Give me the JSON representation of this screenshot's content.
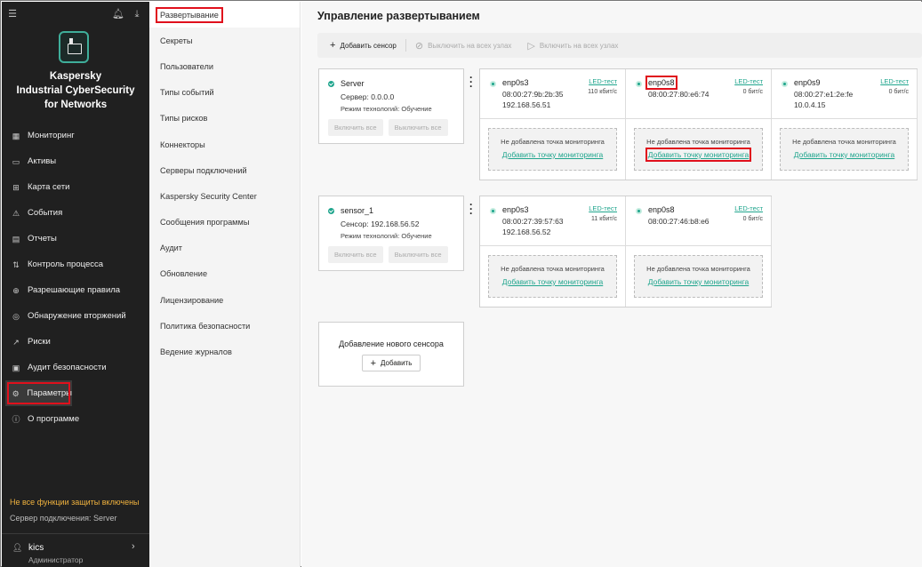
{
  "sidebar": {
    "brand_lines": [
      "Kaspersky",
      "Industrial CyberSecurity",
      "for Networks"
    ],
    "nav": [
      {
        "label": "Мониторинг",
        "icon": "monitoring-icon",
        "glyph": "▦"
      },
      {
        "label": "Активы",
        "icon": "assets-icon",
        "glyph": "▭"
      },
      {
        "label": "Карта сети",
        "icon": "network-map-icon",
        "glyph": "⊞"
      },
      {
        "label": "События",
        "icon": "events-icon",
        "glyph": "⚠"
      },
      {
        "label": "Отчеты",
        "icon": "reports-icon",
        "glyph": "▤"
      },
      {
        "label": "Контроль процесса",
        "icon": "process-control-icon",
        "glyph": "⇅"
      },
      {
        "label": "Разрешающие правила",
        "icon": "allow-rules-icon",
        "glyph": "⊕"
      },
      {
        "label": "Обнаружение вторжений",
        "icon": "intrusion-detection-icon",
        "glyph": "◎"
      },
      {
        "label": "Риски",
        "icon": "risks-icon",
        "glyph": "↗"
      },
      {
        "label": "Аудит безопасности",
        "icon": "security-audit-icon",
        "glyph": "▣"
      },
      {
        "label": "Параметры",
        "icon": "settings-icon",
        "glyph": "⚙"
      },
      {
        "label": "О программе",
        "icon": "about-icon",
        "glyph": "ⓘ"
      }
    ],
    "warning": "Не все функции защиты включены",
    "server": "Сервер подключения:  Server",
    "user": "kics",
    "role": "Администратор"
  },
  "submenu": [
    "Развертывание",
    "Секреты",
    "Пользователи",
    "Типы событий",
    "Типы рисков",
    "Коннекторы",
    "Серверы подключений",
    "Kaspersky Security Center",
    "Сообщения программы",
    "Аудит",
    "Обновление",
    "Лицензирование",
    "Политика безопасности",
    "Ведение журналов"
  ],
  "main": {
    "title": "Управление развертыванием",
    "toolbar": {
      "add_sensor": "Добавить сенсор",
      "disable_all": "Выключить на всех узлах",
      "enable_all": "Включить на всех узлах"
    },
    "sensors": [
      {
        "name": "Server",
        "address": "Сервер: 0.0.0.0",
        "mode": "Режим технологий: Обучение",
        "enable_all": "Включить все",
        "disable_all": "Выключить все",
        "interfaces": [
          {
            "name": "enp0s3",
            "mac": "08:00:27:9b:2b:35",
            "ip": "192.168.56.51",
            "led": "LED-тест",
            "rate": "110 кбит/с",
            "no_point": "Не добавлена точка мониторинга",
            "add_point": "Добавить точку мониторинга"
          },
          {
            "name": "enp0s8",
            "mac": "08:00:27:80:e6:74",
            "ip": "",
            "led": "LED-тест",
            "rate": "0 бит/с",
            "no_point": "Не добавлена точка мониторинга",
            "add_point": "Добавить точку мониторинга"
          },
          {
            "name": "enp0s9",
            "mac": "08:00:27:e1:2e:fe",
            "ip": "10.0.4.15",
            "led": "LED-тест",
            "rate": "0 бит/с",
            "no_point": "Не добавлена точка мониторинга",
            "add_point": "Добавить точку мониторинга"
          }
        ]
      },
      {
        "name": "sensor_1",
        "address": "Сенсор: 192.168.56.52",
        "mode": "Режим технологий: Обучение",
        "enable_all": "Включить все",
        "disable_all": "Выключить все",
        "interfaces": [
          {
            "name": "enp0s3",
            "mac": "08:00:27:39:57:63",
            "ip": "192.168.56.52",
            "led": "LED-тест",
            "rate": "11 кбит/с",
            "no_point": "Не добавлена точка мониторинга",
            "add_point": "Добавить точку мониторинга"
          },
          {
            "name": "enp0s8",
            "mac": "08:00:27:46:b8:e6",
            "ip": "",
            "led": "LED-тест",
            "rate": "0 бит/с",
            "no_point": "Не добавлена точка мониторинга",
            "add_point": "Добавить точку мониторинга"
          }
        ]
      }
    ],
    "new_sensor": {
      "title": "Добавление нового сенсора",
      "button": "Добавить"
    }
  },
  "colors": {
    "accent": "#1fa58d",
    "highlight": "#e0101c",
    "warning": "#f0b23e",
    "sidebar_bg": "#202020"
  }
}
